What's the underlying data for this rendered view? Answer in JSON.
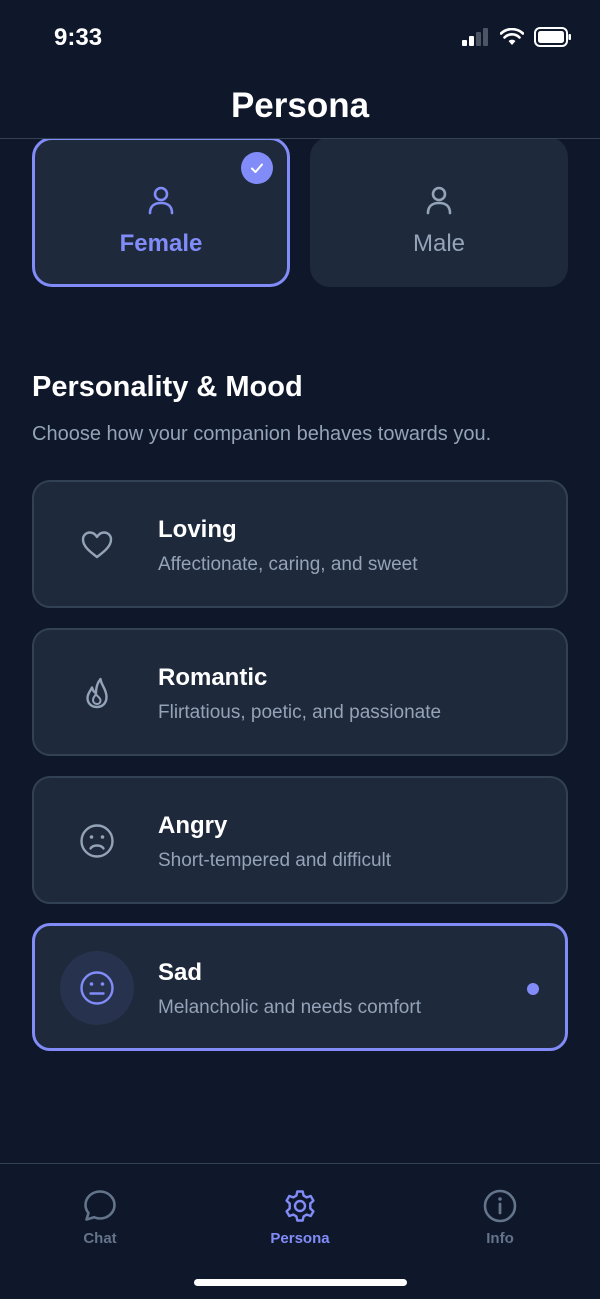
{
  "status_bar": {
    "time": "9:33"
  },
  "header": {
    "title": "Persona"
  },
  "gender": {
    "options": [
      {
        "label": "Female",
        "selected": true,
        "icon": "person-icon"
      },
      {
        "label": "Male",
        "selected": false,
        "icon": "person-icon"
      }
    ]
  },
  "personality": {
    "title": "Personality & Mood",
    "subtitle": "Choose how your companion behaves towards you.",
    "moods": [
      {
        "name": "Loving",
        "description": "Affectionate, caring, and sweet",
        "icon": "heart-icon",
        "selected": false
      },
      {
        "name": "Romantic",
        "description": "Flirtatious, poetic, and passionate",
        "icon": "flame-icon",
        "selected": false
      },
      {
        "name": "Angry",
        "description": "Short-tempered and difficult",
        "icon": "frown-icon",
        "selected": false
      },
      {
        "name": "Sad",
        "description": "Melancholic and needs comfort",
        "icon": "meh-face-icon",
        "selected": true
      }
    ]
  },
  "tabs": [
    {
      "label": "Chat",
      "icon": "chat-bubble-icon",
      "active": false
    },
    {
      "label": "Persona",
      "icon": "gear-icon",
      "active": true
    },
    {
      "label": "Info",
      "icon": "info-icon",
      "active": false
    }
  ],
  "colors": {
    "background": "#0f172a",
    "card": "#1e293b",
    "accent": "#818cf8",
    "muted_text": "#94a3b8"
  }
}
